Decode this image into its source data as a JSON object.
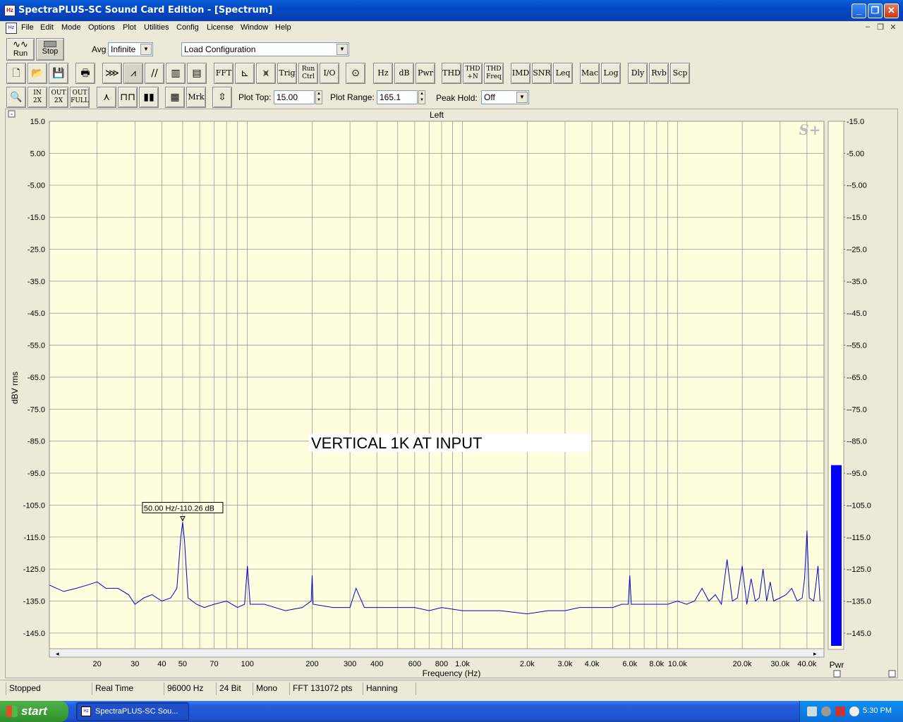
{
  "window": {
    "title": "SpectraPLUS-SC Sound Card Edition - [Spectrum]",
    "icon": "app-icon"
  },
  "menu": [
    "File",
    "Edit",
    "Mode",
    "Options",
    "Plot",
    "Utilities",
    "Config",
    "License",
    "Window",
    "Help"
  ],
  "toolbar1": {
    "run_label": "Run",
    "stop_label": "Stop",
    "avg_label": "Avg",
    "avg_value": "Infinite",
    "config_value": "Load Configuration"
  },
  "toolbar2": {
    "text_buttons": [
      "FFT",
      "Trig",
      "Run Ctrl",
      "I/O",
      "Hz",
      "dB",
      "Pwr",
      "THD",
      "THD +N",
      "THD Freq",
      "IMD",
      "SNR",
      "Leq",
      "Mac",
      "Log",
      "Dly",
      "Rvb",
      "Scp"
    ]
  },
  "toolbar3": {
    "mrk_label": "Mrk",
    "plot_top_label": "Plot Top:",
    "plot_top_value": "15.00",
    "plot_range_label": "Plot Range:",
    "plot_range_value": "165.1",
    "peak_hold_label": "Peak Hold:",
    "peak_hold_value": "Off"
  },
  "plot": {
    "channel_title": "Left",
    "logo": "S+",
    "annotation": "VERTICAL 1K AT INPUT",
    "marker_label": "50.00 Hz/-110.26 dB",
    "colors": {
      "background": "#ffffe0",
      "trace": "#0000cc",
      "bar": "#0000ff"
    }
  },
  "chart_data": {
    "type": "line",
    "title": "Left",
    "xlabel": "Frequency (Hz)",
    "ylabel": "dBV rms",
    "x_scale": "log",
    "xlim": [
      12,
      48000
    ],
    "ylim": [
      -150.1,
      15
    ],
    "grid": true,
    "x_ticks": [
      {
        "v": 20,
        "t": "20"
      },
      {
        "v": 30,
        "t": "30"
      },
      {
        "v": 40,
        "t": "40"
      },
      {
        "v": 50,
        "t": "50"
      },
      {
        "v": 70,
        "t": "70"
      },
      {
        "v": 100,
        "t": "100"
      },
      {
        "v": 200,
        "t": "200"
      },
      {
        "v": 300,
        "t": "300"
      },
      {
        "v": 400,
        "t": "400"
      },
      {
        "v": 600,
        "t": "600"
      },
      {
        "v": 800,
        "t": "800"
      },
      {
        "v": 1000,
        "t": "1.0k"
      },
      {
        "v": 2000,
        "t": "2.0k"
      },
      {
        "v": 3000,
        "t": "3.0k"
      },
      {
        "v": 4000,
        "t": "4.0k"
      },
      {
        "v": 6000,
        "t": "6.0k"
      },
      {
        "v": 8000,
        "t": "8.0k"
      },
      {
        "v": 10000,
        "t": "10.0k"
      },
      {
        "v": 20000,
        "t": "20.0k"
      },
      {
        "v": 30000,
        "t": "30.0k"
      },
      {
        "v": 40000,
        "t": "40.0k"
      }
    ],
    "y_ticks": [
      "15.0",
      "5.00",
      "-5.00",
      "-15.0",
      "-25.0",
      "-35.0",
      "-45.0",
      "-55.0",
      "-65.0",
      "-75.0",
      "-85.0",
      "-95.0",
      "-105.0",
      "-115.0",
      "-125.0",
      "-135.0",
      "-145.0"
    ],
    "series": [
      {
        "x": [
          12,
          14,
          16,
          18,
          20,
          22,
          25,
          28,
          30,
          33,
          36,
          40,
          44,
          47,
          49,
          50,
          51,
          53,
          58,
          63,
          70,
          80,
          90,
          97,
          100,
          103,
          120,
          150,
          180,
          198,
          200,
          202,
          250,
          300,
          320,
          350,
          400,
          500,
          600,
          700,
          800,
          1000,
          1200,
          1500,
          2000,
          2500,
          3000,
          3500,
          4000,
          4500,
          5000,
          5500,
          5900,
          6000,
          6100,
          7000,
          8000,
          9000,
          10000,
          11000,
          12000,
          13000,
          14000,
          15000,
          16000,
          17000,
          18000,
          19000,
          20000,
          21000,
          22000,
          23000,
          24000,
          25000,
          26000,
          27000,
          28000,
          30000,
          32000,
          34000,
          36000,
          38000,
          39000,
          40000,
          41000,
          43000,
          44000,
          45000,
          46000
        ],
        "y": [
          -130,
          -132,
          -131,
          -130,
          -129,
          -131,
          -131,
          -133,
          -136,
          -134,
          -133,
          -135,
          -134,
          -131,
          -115,
          -110.3,
          -116,
          -134,
          -136,
          -137,
          -136,
          -135,
          -137,
          -136,
          -124,
          -136,
          -136,
          -138,
          -137,
          -135,
          -127,
          -136,
          -137,
          -137,
          -131,
          -137,
          -137,
          -137,
          -137,
          -138,
          -137,
          -138,
          -138,
          -138,
          -139,
          -138,
          -138,
          -137,
          -137,
          -137,
          -137,
          -136,
          -136,
          -127,
          -136,
          -136,
          -136,
          -136,
          -135,
          -136,
          -135,
          -131,
          -135,
          -133,
          -136,
          -122,
          -135,
          -134,
          -124,
          -136,
          -128,
          -135,
          -134,
          -125,
          -135,
          -129,
          -135,
          -134,
          -133,
          -131,
          -135,
          -134,
          -128,
          -113,
          -134,
          -135,
          -130,
          -124,
          -135
        ]
      }
    ],
    "level_bar": {
      "label": "Pwr",
      "value": -92.5
    }
  },
  "status": [
    "Stopped",
    "Real Time",
    "96000 Hz",
    "24 Bit",
    "Mono",
    "FFT 131072 pts",
    "Hanning"
  ],
  "taskbar": {
    "start_label": "start",
    "task_label": "SpectraPLUS-SC Sou...",
    "clock": "5:30 PM"
  }
}
